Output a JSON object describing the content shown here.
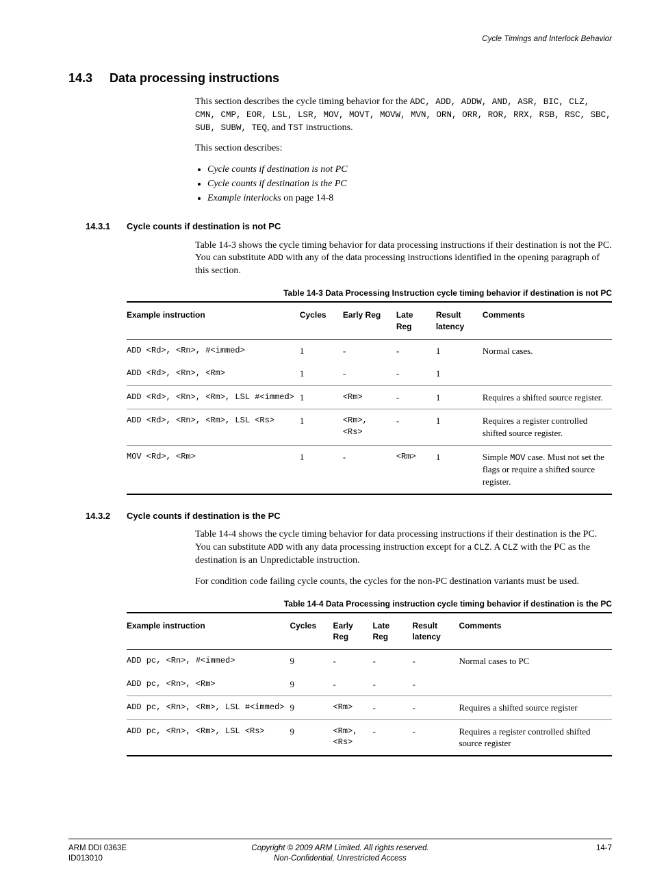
{
  "running_header": "Cycle Timings and Interlock Behavior",
  "section": {
    "num": "14.3",
    "title": "Data processing instructions",
    "intro_a": "This section describes the cycle timing behavior for the ",
    "intro_mono": "ADC, ADD, ADDW, AND, ASR, BIC, CLZ, CMN, CMP, EOR, LSL, LSR, MOV, MOVT, MOVW, MVN, ORN, ORR, ROR, RRX, RSB, RSC, SBC, SUB, SUBW, TEQ",
    "intro_b": ", and ",
    "intro_mono2": "TST",
    "intro_c": " instructions.",
    "describes": "This section describes:",
    "bullets": [
      {
        "italic": "Cycle counts if destination is not PC",
        "tail": ""
      },
      {
        "italic": "Cycle counts if destination is the PC",
        "tail": ""
      },
      {
        "italic": "Example interlocks",
        "tail": " on page 14-8"
      }
    ]
  },
  "sub1": {
    "num": "14.3.1",
    "title": "Cycle counts if destination is not PC",
    "para_a": "Table 14-3 shows the cycle timing behavior for data processing instructions if their destination is not the PC. You can substitute ",
    "para_mono": "ADD",
    "para_b": " with any of the data processing instructions identified in the opening paragraph of this section.",
    "table_caption": "Table 14-3 Data Processing Instruction cycle timing behavior if destination is not PC",
    "headers": [
      "Example instruction",
      "Cycles",
      "Early Reg",
      "Late Reg",
      "Result latency",
      "Comments"
    ],
    "rows": [
      {
        "inst": "ADD <Rd>, <Rn>, #<immed>",
        "cycles": "1",
        "early": "-",
        "late": "-",
        "res": "1",
        "comment": "Normal cases.",
        "rowspan_comment": 2
      },
      {
        "inst": "ADD <Rd>, <Rn>, <Rm>",
        "cycles": "1",
        "early": "-",
        "late": "-",
        "res": "1",
        "comment": null
      },
      {
        "inst": "ADD <Rd>, <Rn>, <Rm>, LSL #<immed>",
        "cycles": "1",
        "early": "<Rm>",
        "late": "-",
        "res": "1",
        "comment": "Requires a shifted source register."
      },
      {
        "inst": "ADD <Rd>, <Rn>, <Rm>, LSL <Rs>",
        "cycles": "1",
        "early": "<Rm>, <Rs>",
        "late": "-",
        "res": "1",
        "comment": "Requires a register controlled shifted source register."
      },
      {
        "inst": "MOV <Rd>, <Rm>",
        "cycles": "1",
        "early": "-",
        "late": "<Rm>",
        "res": "1",
        "comment_pre": "Simple ",
        "comment_mono": "MOV",
        "comment_post": " case. Must not set the flags or require a shifted source register."
      }
    ]
  },
  "sub2": {
    "num": "14.3.2",
    "title": "Cycle counts if destination is the PC",
    "para1_a": "Table 14-4 shows the cycle timing behavior for data processing instructions if their destination is the PC. You can substitute ",
    "para1_mono1": "ADD",
    "para1_b": " with any data processing instruction except for a ",
    "para1_mono2": "CLZ",
    "para1_c": ". A ",
    "para1_mono3": "CLZ",
    "para1_d": " with the PC as the destination is an Unpredictable instruction.",
    "para2": "For condition code failing cycle counts, the cycles for the non-PC destination variants must be used.",
    "table_caption": "Table 14-4 Data Processing instruction cycle timing behavior if destination is the PC",
    "headers": [
      "Example instruction",
      "Cycles",
      "Early Reg",
      "Late Reg",
      "Result latency",
      "Comments"
    ],
    "rows": [
      {
        "inst": "ADD pc, <Rn>, #<immed>",
        "cycles": "9",
        "early": "-",
        "late": "-",
        "res": "-",
        "comment": "Normal cases to PC",
        "rowspan_comment": 2
      },
      {
        "inst": "ADD pc, <Rn>, <Rm>",
        "cycles": "9",
        "early": "-",
        "late": "-",
        "res": "-",
        "comment": null
      },
      {
        "inst": "ADD pc, <Rn>, <Rm>, LSL #<immed>",
        "cycles": "9",
        "early": "<Rm>",
        "late": "-",
        "res": "-",
        "comment": "Requires a shifted source register"
      },
      {
        "inst": "ADD pc, <Rn>, <Rm>, LSL <Rs>",
        "cycles": "9",
        "early": "<Rm>, <Rs>",
        "late": "-",
        "res": "-",
        "comment": "Requires a register controlled shifted source register"
      }
    ]
  },
  "footer": {
    "left1": "ARM DDI 0363E",
    "left2": "ID013010",
    "center1": "Copyright © 2009 ARM Limited. All rights reserved.",
    "center2": "Non-Confidential, Unrestricted Access",
    "right": "14-7"
  }
}
